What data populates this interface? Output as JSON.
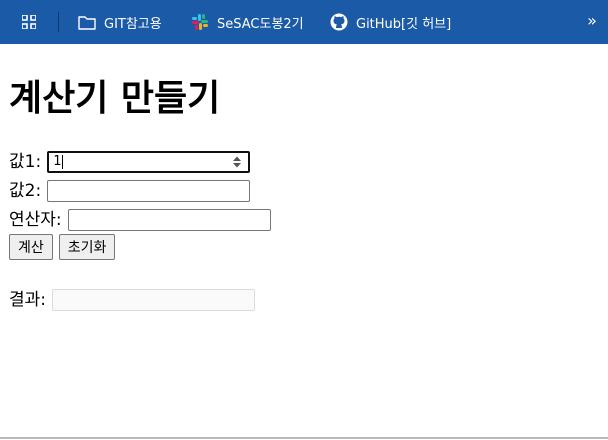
{
  "bookmarks_bar": {
    "items": [
      {
        "label": "GIT참고용",
        "icon": "folder-icon"
      },
      {
        "label": "SeSAC도봉2기",
        "icon": "slack-icon"
      },
      {
        "label": "GitHub[깃 허브]",
        "icon": "github-icon"
      }
    ],
    "overflow": "»"
  },
  "page": {
    "title": "계산기 만들기",
    "value1_label": "값1:",
    "value1": "1",
    "value2_label": "값2:",
    "value2": "",
    "operator_label": "연산자:",
    "operator": "",
    "calc_button": "계산",
    "reset_button": "초기화",
    "result_label": "결과:",
    "result": ""
  },
  "colors": {
    "bookmarks_bar_bg": "#1b5aa6",
    "page_bg": "#ffffff"
  }
}
